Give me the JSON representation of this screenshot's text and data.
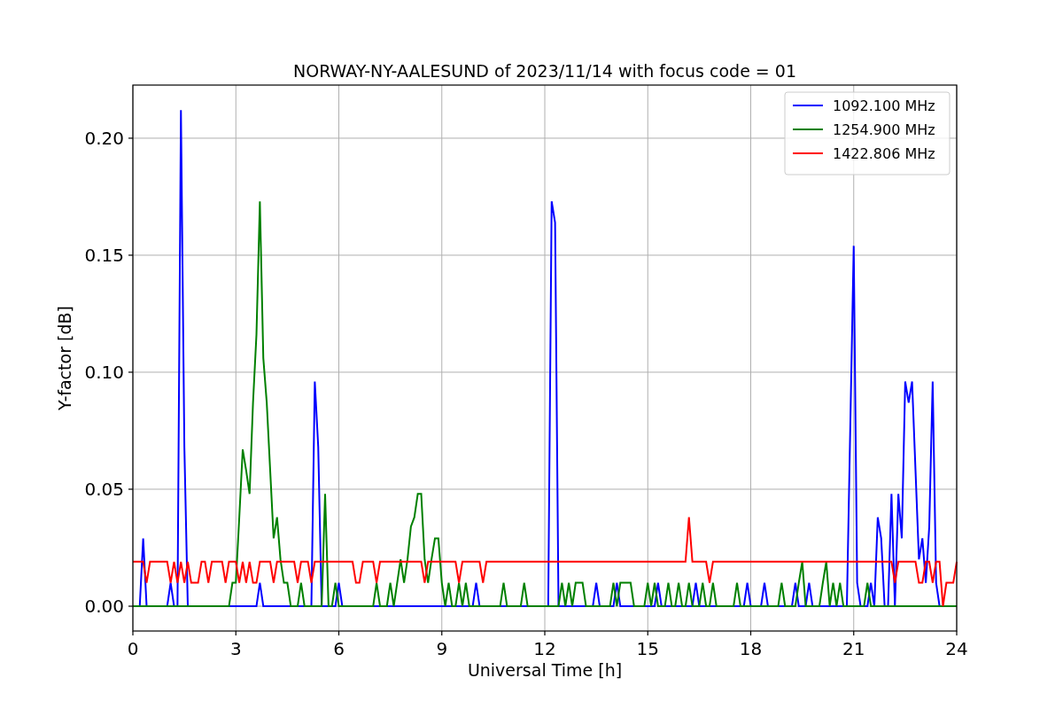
{
  "figure": {
    "chart_data": {
      "type": "line",
      "title": "NORWAY-NY-AALESUND of 2023/11/14 with focus code = 01",
      "xlabel": "Universal Time [h]",
      "ylabel": "Y-factor [dB]",
      "x": [
        0,
        0.1,
        0.2,
        0.3,
        0.4,
        0.5,
        0.6,
        0.7,
        0.8,
        0.9,
        1,
        1.1,
        1.2,
        1.3,
        1.4,
        1.5,
        1.6,
        1.7,
        1.8,
        1.9,
        2,
        2.1,
        2.2,
        2.3,
        2.4,
        2.5,
        2.6,
        2.7,
        2.8,
        2.9,
        3,
        3.1,
        3.2,
        3.3,
        3.4,
        3.5,
        3.6,
        3.7,
        3.8,
        3.9,
        4,
        4.1,
        4.2,
        4.3,
        4.4,
        4.5,
        4.6,
        4.7,
        4.8,
        4.9,
        5,
        5.1,
        5.2,
        5.3,
        5.4,
        5.5,
        5.6,
        5.7,
        5.8,
        5.9,
        6,
        6.1,
        6.2,
        6.3,
        6.4,
        6.5,
        6.6,
        6.7,
        6.8,
        6.9,
        7,
        7.1,
        7.2,
        7.3,
        7.4,
        7.5,
        7.6,
        7.7,
        7.8,
        7.9,
        8,
        8.1,
        8.2,
        8.3,
        8.4,
        8.5,
        8.6,
        8.7,
        8.8,
        8.9,
        9,
        9.1,
        9.2,
        9.3,
        9.4,
        9.5,
        9.6,
        9.7,
        9.8,
        9.9,
        10,
        10.1,
        10.2,
        10.3,
        10.4,
        10.5,
        10.6,
        10.7,
        10.8,
        10.9,
        11,
        11.1,
        11.2,
        11.3,
        11.4,
        11.5,
        11.6,
        11.7,
        11.8,
        11.9,
        12,
        12.1,
        12.2,
        12.3,
        12.4,
        12.5,
        12.6,
        12.7,
        12.8,
        12.9,
        13,
        13.1,
        13.2,
        13.3,
        13.4,
        13.5,
        13.6,
        13.7,
        13.8,
        13.9,
        14,
        14.1,
        14.2,
        14.3,
        14.4,
        14.5,
        14.6,
        14.7,
        14.8,
        14.9,
        15,
        15.1,
        15.2,
        15.3,
        15.4,
        15.5,
        15.6,
        15.7,
        15.8,
        15.9,
        16,
        16.1,
        16.2,
        16.3,
        16.4,
        16.5,
        16.6,
        16.7,
        16.8,
        16.9,
        17,
        17.1,
        17.2,
        17.3,
        17.4,
        17.5,
        17.6,
        17.7,
        17.8,
        17.9,
        18,
        18.1,
        18.2,
        18.3,
        18.4,
        18.5,
        18.6,
        18.7,
        18.8,
        18.9,
        19,
        19.1,
        19.2,
        19.3,
        19.4,
        19.5,
        19.6,
        19.7,
        19.8,
        19.9,
        20,
        20.1,
        20.2,
        20.3,
        20.4,
        20.5,
        20.6,
        20.7,
        20.8,
        20.9,
        21,
        21.1,
        21.2,
        21.3,
        21.4,
        21.5,
        21.6,
        21.7,
        21.8,
        21.9,
        22,
        22.1,
        22.2,
        22.3,
        22.4,
        22.5,
        22.6,
        22.7,
        22.8,
        22.9,
        23,
        23.1,
        23.2,
        23.3,
        23.4,
        23.5,
        23.6,
        23.7,
        23.8,
        23.9,
        24
      ],
      "series": [
        {
          "name": "1092.100 MHz",
          "color": "#0000ff",
          "values": [
            0,
            0,
            0,
            0.029,
            0,
            0,
            0,
            0,
            0,
            0,
            0,
            0.01,
            0,
            0,
            0.212,
            0.068,
            0,
            0,
            0,
            0,
            0,
            0,
            0,
            0,
            0,
            0,
            0,
            0,
            0,
            0,
            0,
            0,
            0,
            0,
            0,
            0,
            0,
            0.01,
            0,
            0,
            0,
            0,
            0,
            0,
            0,
            0,
            0,
            0,
            0,
            0,
            0,
            0,
            0,
            0.096,
            0.068,
            0,
            0,
            0,
            0,
            0,
            0.01,
            0,
            0,
            0,
            0,
            0,
            0,
            0,
            0,
            0,
            0,
            0,
            0,
            0,
            0,
            0,
            0,
            0,
            0,
            0,
            0,
            0,
            0,
            0,
            0,
            0,
            0,
            0,
            0,
            0,
            0,
            0,
            0,
            0,
            0,
            0,
            0,
            0,
            0,
            0,
            0.01,
            0,
            0,
            0,
            0,
            0,
            0,
            0,
            0,
            0,
            0,
            0,
            0,
            0,
            0,
            0,
            0,
            0,
            0,
            0,
            0,
            0,
            0.173,
            0.164,
            0,
            0,
            0,
            0,
            0,
            0,
            0,
            0,
            0,
            0,
            0,
            0.01,
            0,
            0,
            0,
            0,
            0,
            0.01,
            0,
            0,
            0,
            0,
            0,
            0,
            0,
            0,
            0,
            0,
            0,
            0.01,
            0,
            0,
            0,
            0,
            0,
            0,
            0,
            0,
            0,
            0,
            0.01,
            0,
            0,
            0,
            0,
            0,
            0,
            0,
            0,
            0,
            0,
            0,
            0,
            0,
            0,
            0.01,
            0,
            0,
            0,
            0,
            0.01,
            0,
            0,
            0,
            0,
            0,
            0,
            0,
            0,
            0.01,
            0,
            0,
            0,
            0.01,
            0,
            0,
            0,
            0,
            0,
            0,
            0,
            0,
            0,
            0,
            0,
            0.077,
            0.154,
            0.01,
            0,
            0,
            0,
            0.01,
            0,
            0.038,
            0.029,
            0,
            0,
            0.048,
            0,
            0.048,
            0.029,
            0.096,
            0.087,
            0.096,
            0.058,
            0.02,
            0.029,
            0.01,
            0.034,
            0.096,
            0.01,
            0,
            0,
            0,
            null,
            null,
            null
          ]
        },
        {
          "name": "1254.900 MHz",
          "color": "#008000",
          "values": [
            0,
            0,
            0,
            0,
            0,
            0,
            0,
            0,
            0,
            0,
            0,
            0,
            0,
            0,
            0,
            0,
            0,
            0,
            0,
            0,
            0,
            0,
            0,
            0,
            0,
            0,
            0,
            0,
            0,
            0.01,
            0.01,
            0.038,
            0.067,
            0.058,
            0.048,
            0.087,
            0.116,
            0.173,
            0.106,
            0.087,
            0.058,
            0.029,
            0.038,
            0.02,
            0.01,
            0.01,
            0,
            0,
            0,
            0.01,
            0,
            0,
            0,
            0,
            0,
            0,
            0.048,
            0,
            0,
            0.01,
            0,
            0,
            0,
            0,
            0,
            0,
            0,
            0,
            0,
            0,
            0,
            0.01,
            0,
            0,
            0,
            0.01,
            0,
            0.01,
            0.02,
            0.01,
            0.02,
            0.034,
            0.038,
            0.048,
            0.048,
            0.02,
            0.01,
            0.02,
            0.029,
            0.029,
            0.01,
            0,
            0.01,
            0,
            0,
            0.01,
            0,
            0.01,
            0,
            0,
            0,
            0,
            0,
            0,
            0,
            0,
            0,
            0,
            0.01,
            0,
            0,
            0,
            0,
            0,
            0.01,
            0,
            0,
            0,
            0,
            0,
            0,
            0,
            0,
            0,
            0,
            0.01,
            0,
            0.01,
            0,
            0.01,
            0.01,
            0.01,
            0,
            0,
            0,
            0,
            0,
            0,
            0,
            0,
            0.01,
            0,
            0.01,
            0.01,
            0.01,
            0.01,
            0,
            0,
            0,
            0,
            0.01,
            0,
            0.01,
            0,
            0,
            0,
            0.01,
            0,
            0,
            0.01,
            0,
            0,
            0.01,
            0,
            0,
            0,
            0.01,
            0,
            0,
            0.01,
            0,
            0,
            0,
            0,
            0,
            0,
            0.01,
            0,
            0,
            0,
            0,
            0,
            0,
            0,
            0,
            0,
            0,
            0,
            0,
            0.01,
            0,
            0,
            0,
            0,
            0.01,
            0.019,
            0,
            0,
            0,
            0,
            0,
            0.01,
            0.019,
            0,
            0.01,
            0,
            0.01,
            0,
            0,
            0,
            0,
            0,
            0,
            0,
            0.01,
            0,
            0,
            0,
            0,
            0,
            0,
            0,
            0,
            0,
            0,
            0,
            0,
            0,
            0,
            0,
            0,
            0,
            0,
            0,
            0,
            0,
            0,
            0,
            0,
            0,
            0
          ]
        },
        {
          "name": "1422.806 MHz",
          "color": "#ff0000",
          "values": [
            0.019,
            0.019,
            0.019,
            0.019,
            0.01,
            0.019,
            0.019,
            0.019,
            0.019,
            0.019,
            0.019,
            0.01,
            0.019,
            0.01,
            0.019,
            0.01,
            0.019,
            0.01,
            0.01,
            0.01,
            0.019,
            0.019,
            0.01,
            0.019,
            0.019,
            0.019,
            0.019,
            0.01,
            0.019,
            0.019,
            0.019,
            0.01,
            0.019,
            0.01,
            0.019,
            0.01,
            0.01,
            0.019,
            0.019,
            0.019,
            0.019,
            0.01,
            0.019,
            0.019,
            0.019,
            0.019,
            0.019,
            0.019,
            0.01,
            0.019,
            0.019,
            0.019,
            0.01,
            0.019,
            0.019,
            0.019,
            0.019,
            0.019,
            0.019,
            0.019,
            0.019,
            0.019,
            0.019,
            0.019,
            0.019,
            0.01,
            0.01,
            0.019,
            0.019,
            0.019,
            0.019,
            0.01,
            0.019,
            0.019,
            0.019,
            0.019,
            0.019,
            0.019,
            0.019,
            0.019,
            0.019,
            0.019,
            0.019,
            0.019,
            0.019,
            0.01,
            0.019,
            0.019,
            0.019,
            0.019,
            0.019,
            0.019,
            0.019,
            0.019,
            0.019,
            0.01,
            0.019,
            0.019,
            0.019,
            0.019,
            0.019,
            0.019,
            0.01,
            0.019,
            0.019,
            0.019,
            0.019,
            0.019,
            0.019,
            0.019,
            0.019,
            0.019,
            0.019,
            0.019,
            0.019,
            0.019,
            0.019,
            0.019,
            0.019,
            0.019,
            0.019,
            0.019,
            0.019,
            0.019,
            0.019,
            0.019,
            0.019,
            0.019,
            0.019,
            0.019,
            0.019,
            0.019,
            0.019,
            0.019,
            0.019,
            0.019,
            0.019,
            0.019,
            0.019,
            0.019,
            0.019,
            0.019,
            0.019,
            0.019,
            0.019,
            0.019,
            0.019,
            0.019,
            0.019,
            0.019,
            0.019,
            0.019,
            0.019,
            0.019,
            0.019,
            0.019,
            0.019,
            0.019,
            0.019,
            0.019,
            0.019,
            0.019,
            0.038,
            0.019,
            0.019,
            0.019,
            0.019,
            0.019,
            0.01,
            0.019,
            0.019,
            0.019,
            0.019,
            0.019,
            0.019,
            0.019,
            0.019,
            0.019,
            0.019,
            0.019,
            0.019,
            0.019,
            0.019,
            0.019,
            0.019,
            0.019,
            0.019,
            0.019,
            0.019,
            0.019,
            0.019,
            0.019,
            0.019,
            0.019,
            0.019,
            0.019,
            0.019,
            0.019,
            0.019,
            0.019,
            0.019,
            0.019,
            0.019,
            0.019,
            0.019,
            0.019,
            0.019,
            0.019,
            0.019,
            0.019,
            0.019,
            0.019,
            0.019,
            0.019,
            0.019,
            0.019,
            0.019,
            0.019,
            0.019,
            0.019,
            0.019,
            0.019,
            0.01,
            0.019,
            0.019,
            0.019,
            0.019,
            0.019,
            0.019,
            0.01,
            0.01,
            0.019,
            0.019,
            0.01,
            0.019,
            0.019,
            0,
            0.01,
            0.01,
            0.01,
            0.019
          ]
        }
      ],
      "grid": true,
      "legend": true,
      "xlim": [
        0,
        24
      ],
      "ylim": [
        -0.0106,
        0.2227
      ],
      "xticks": [
        0,
        3,
        6,
        9,
        12,
        15,
        18,
        21,
        24
      ],
      "yticks": [
        {
          "value": 0,
          "label": "0.00"
        },
        {
          "value": 0.05,
          "label": "0.05"
        },
        {
          "value": 0.1,
          "label": "0.10"
        },
        {
          "value": 0.15,
          "label": "0.15"
        },
        {
          "value": 0.2,
          "label": "0.20"
        }
      ]
    }
  }
}
